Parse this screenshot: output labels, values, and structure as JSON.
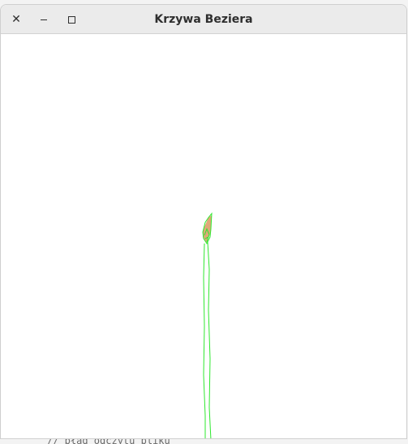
{
  "window": {
    "title": "Krzywa Beziera",
    "buttons": {
      "close_icon": "close-icon",
      "minimize_icon": "minimize-icon",
      "maximize_icon": "maximize-icon"
    }
  },
  "canvas": {
    "background": "#ffffff",
    "stroke_color": "#2ee82e",
    "fill_color": "#e0a878"
  },
  "desktop": {
    "peek_text": "// błąd odczytu pliku"
  }
}
